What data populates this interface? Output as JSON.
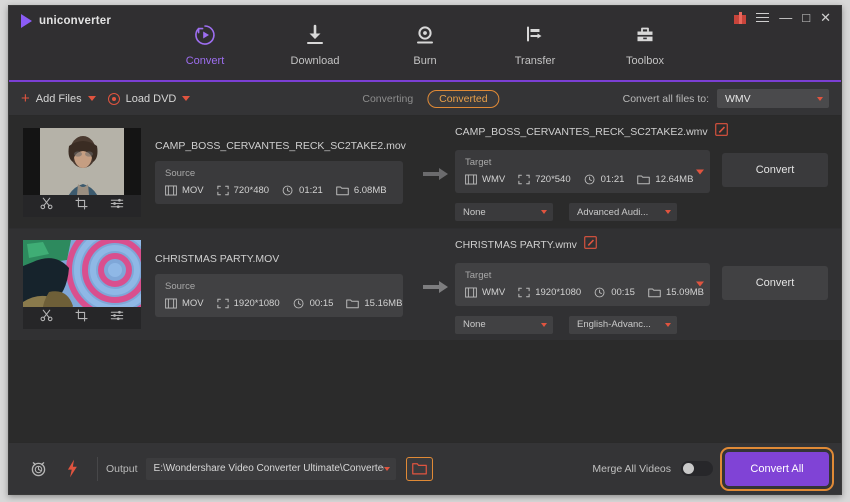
{
  "window": {
    "title": "uniconverter",
    "controls": {
      "gift": "gift-icon",
      "menu": "hamburger-icon",
      "minimize": "—",
      "maximize": "□",
      "close": "✕"
    }
  },
  "nav": {
    "items": [
      {
        "label": "Convert",
        "icon": "convert-icon",
        "active": true
      },
      {
        "label": "Download",
        "icon": "download-icon",
        "active": false
      },
      {
        "label": "Burn",
        "icon": "burn-icon",
        "active": false
      },
      {
        "label": "Transfer",
        "icon": "transfer-icon",
        "active": false
      },
      {
        "label": "Toolbox",
        "icon": "toolbox-icon",
        "active": false
      }
    ]
  },
  "toolbar": {
    "add_files": "Add Files",
    "load_dvd": "Load DVD",
    "tab_converting": "Converting",
    "tab_converted": "Converted",
    "convert_all_to_label": "Convert all files to:",
    "convert_all_to_value": "WMV"
  },
  "files": [
    {
      "name": "CAMP_BOSS_CERVANTES_RECK_SC2TAKE2.mov",
      "source": {
        "title": "Source",
        "format": "MOV",
        "resolution": "720*480",
        "duration": "01:21",
        "size": "6.08MB"
      },
      "target": {
        "name": "CAMP_BOSS_CERVANTES_RECK_SC2TAKE2.wmv",
        "title": "Target",
        "format": "WMV",
        "resolution": "720*540",
        "duration": "01:21",
        "size": "12.64MB"
      },
      "subtitle_select": "None",
      "audio_select": "Advanced Audi...",
      "convert_button": "Convert"
    },
    {
      "name": "CHRISTMAS PARTY.MOV",
      "source": {
        "title": "Source",
        "format": "MOV",
        "resolution": "1920*1080",
        "duration": "00:15",
        "size": "15.16MB"
      },
      "target": {
        "name": "CHRISTMAS PARTY.wmv",
        "title": "Target",
        "format": "WMV",
        "resolution": "1920*1080",
        "duration": "00:15",
        "size": "15.09MB"
      },
      "subtitle_select": "None",
      "audio_select": "English-Advanc...",
      "convert_button": "Convert"
    }
  ],
  "bottom": {
    "output_label": "Output",
    "output_path": "E:\\Wondershare Video Converter Ultimate\\Converted",
    "merge_label": "Merge All Videos",
    "convert_all_button": "Convert All",
    "timer_icon": "alarm-clock-icon",
    "speed_icon": "lightning-bolt-icon",
    "folder_icon": "folder-icon"
  },
  "colors": {
    "accent_purple": "#8043d6",
    "accent_orange": "#e08a36",
    "accent_red": "#e0543f",
    "panel_bg": "#2b2b2b",
    "bar_bg": "#343436"
  }
}
